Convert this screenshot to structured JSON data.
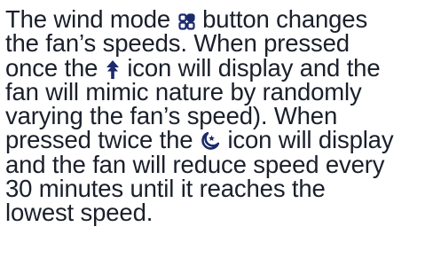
{
  "paragraph": {
    "lines": [
      {
        "before": "The wind mode",
        "icon": "wind-mode-icon",
        "after": "button changes"
      },
      {
        "text": "the fan’s speeds. When pressed"
      },
      {
        "before": "once the",
        "icon": "wind-arrow-icon",
        "after": "icon will display and the"
      },
      {
        "text": "fan will mimic nature by randomly"
      },
      {
        "text": "varying the fan’s speed). When"
      },
      {
        "before": "pressed twice the",
        "icon": "sleep-moon-icon",
        "after": "icon will display"
      },
      {
        "text": "and the fan will reduce speed every"
      },
      {
        "text": "30 minutes until it reaches the"
      },
      {
        "text": "lowest speed."
      }
    ]
  },
  "colors": {
    "text": "#1a1f2b",
    "icon": "#1a2a6c"
  }
}
